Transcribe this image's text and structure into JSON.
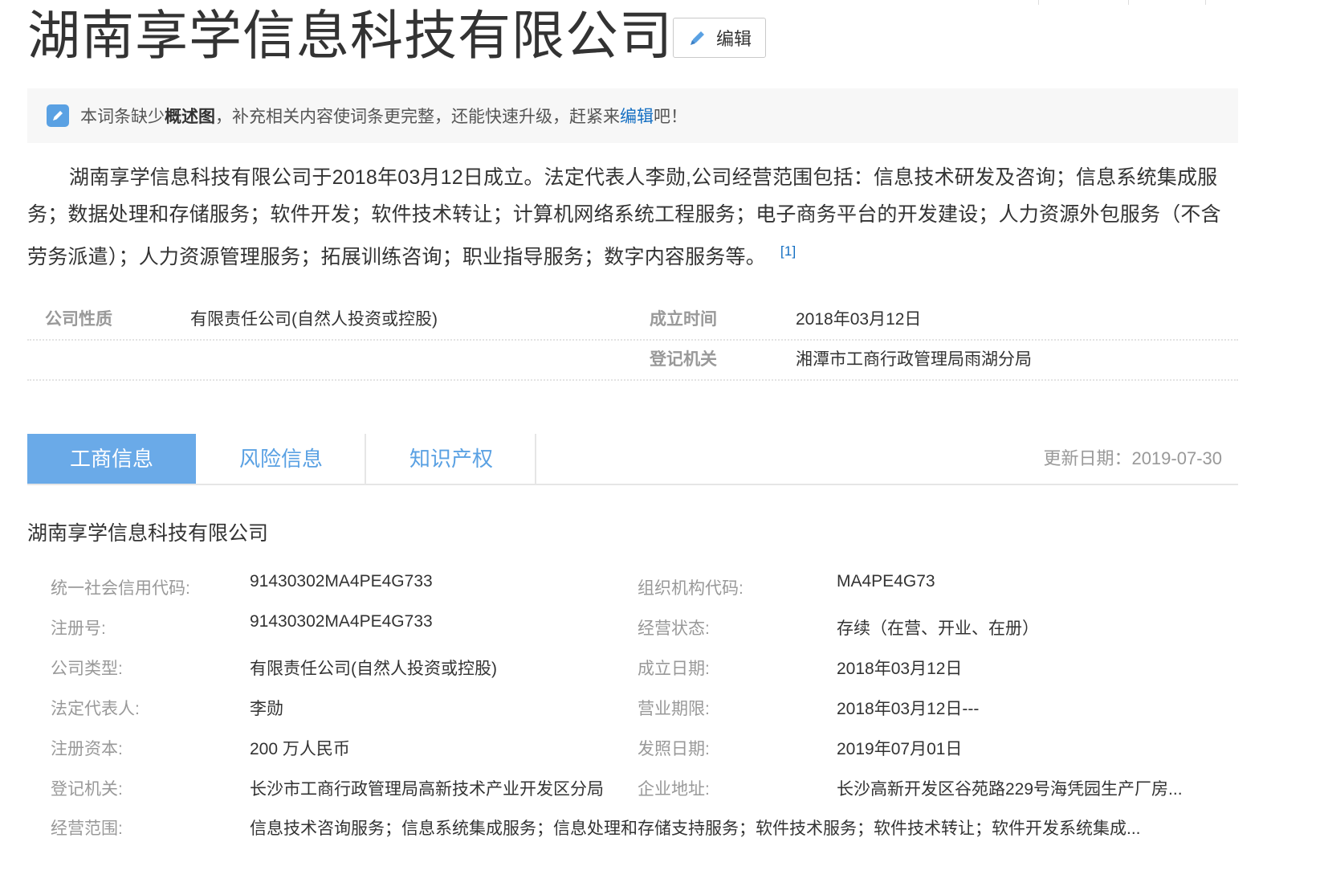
{
  "header": {
    "title": "湖南享学信息科技有限公司",
    "edit_label": "编辑"
  },
  "notice": {
    "prefix": "本词条缺少",
    "bold": "概述图",
    "middle": "，补充相关内容使词条更完整，还能快速升级，赶紧来",
    "link": "编辑",
    "suffix": "吧！"
  },
  "summary": {
    "text": "湖南享学信息科技有限公司于2018年03月12日成立。法定代表人李勋,公司经营范围包括：信息技术研发及咨询；信息系统集成服务；数据处理和存储服务；软件开发；软件技术转让；计算机网络系统工程服务；电子商务平台的开发建设；人力资源外包服务（不含劳务派遣）；人力资源管理服务；拓展训练咨询；职业指导服务；数字内容服务等。",
    "ref": "[1]"
  },
  "basic_info": {
    "company_type_label": "公司性质",
    "company_type_value": "有限责任公司(自然人投资或控股)",
    "founded_label": "成立时间",
    "founded_value": "2018年03月12日",
    "authority_label": "登记机关",
    "authority_value": "湘潭市工商行政管理局雨湖分局"
  },
  "tabs": [
    {
      "label": "工商信息",
      "active": true
    },
    {
      "label": "风险信息",
      "active": false
    },
    {
      "label": "知识产权",
      "active": false
    }
  ],
  "update_date": "更新日期：2019-07-30",
  "detail": {
    "title": "湖南享学信息科技有限公司",
    "rows": [
      {
        "l1": "统一社会信用代码:",
        "v1": "91430302MA4PE4G733",
        "l2": "组织机构代码:",
        "v2": "MA4PE4G73"
      },
      {
        "l1": "注册号:",
        "v1": "91430302MA4PE4G733",
        "l2": "经营状态:",
        "v2": "存续（在营、开业、在册）"
      },
      {
        "l1": "公司类型:",
        "v1": "有限责任公司(自然人投资或控股)",
        "l2": "成立日期:",
        "v2": "2018年03月12日"
      },
      {
        "l1": "法定代表人:",
        "v1": "李勋",
        "l2": "营业期限:",
        "v2": "2018年03月12日---"
      },
      {
        "l1": "注册资本:",
        "v1": "200 万人民币",
        "l2": "发照日期:",
        "v2": "2019年07月01日"
      },
      {
        "l1": "登记机关:",
        "v1": "长沙市工商行政管理局高新技术产业开发区分局",
        "l2": "企业地址:",
        "v2": "长沙高新开发区谷苑路229号海凭园生产厂房..."
      },
      {
        "l1": "经营范围:",
        "v1": "信息技术咨询服务；信息系统集成服务；信息处理和存储支持服务；软件技术服务；软件技术转让；软件开发系统集成..."
      }
    ]
  },
  "colors": {
    "accent": "#5aa1e3",
    "link": "#136ec2",
    "tab_active_bg": "#6aaae8"
  }
}
